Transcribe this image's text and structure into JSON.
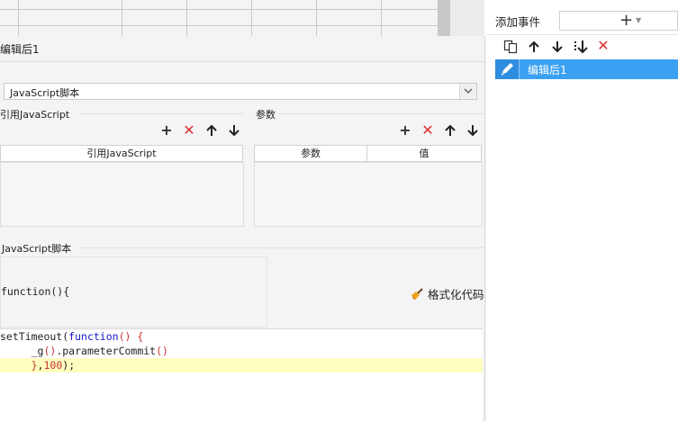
{
  "panel": {
    "title": "编辑后1"
  },
  "script_type": {
    "selected": "JavaScript脚本"
  },
  "ref_js": {
    "label": "引用JavaScript",
    "column": "引用JavaScript"
  },
  "params": {
    "label": "参数",
    "columns": [
      "参数",
      "值"
    ]
  },
  "script": {
    "label": "JavaScript脚本",
    "header": "function(){",
    "format_button": "格式化代码",
    "code": {
      "line1": {
        "a": "setTimeout(",
        "b": "function",
        "c": "()",
        "d": " {"
      },
      "line2": {
        "a": "     _g",
        "b": "()",
        "c": ".parameterCommit",
        "d": "()"
      },
      "line3": {
        "a": "     }",
        "b": ",",
        "c": "100",
        "d": ");"
      }
    }
  },
  "events": {
    "add_label": "添加事件",
    "add_button": "+",
    "items": [
      {
        "label": "编辑后1",
        "selected": true
      }
    ]
  },
  "colors": {
    "accent": "#3aa0f2",
    "delete": "#e03030",
    "code_keyword": "#1515c8",
    "code_highlight": "#ffffbf"
  }
}
